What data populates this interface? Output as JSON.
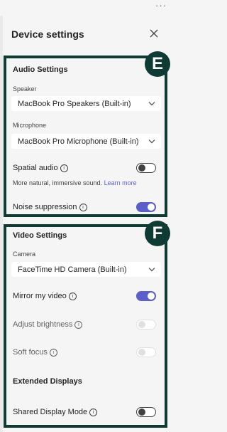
{
  "topbar": {
    "more_glyph": "···"
  },
  "header": {
    "title": "Device settings",
    "close_icon": "close-icon"
  },
  "badges": {
    "e": "E",
    "f": "F"
  },
  "audio": {
    "heading": "Audio Settings",
    "speaker_label": "Speaker",
    "speaker_value": "MacBook Pro Speakers (Built-in)",
    "microphone_label": "Microphone",
    "microphone_value": "MacBook Pro Microphone (Built-in)",
    "spatial_label": "Spatial audio",
    "spatial_on": false,
    "spatial_desc": "More natural, immersive sound.",
    "spatial_link": "Learn more",
    "noise_label": "Noise suppression",
    "noise_on": true
  },
  "video": {
    "heading": "Video Settings",
    "camera_label": "Camera",
    "camera_value": "FaceTime HD Camera (Built-in)",
    "mirror_label": "Mirror my video",
    "mirror_on": true,
    "brightness_label": "Adjust brightness",
    "brightness_enabled": false,
    "softfocus_label": "Soft focus",
    "softfocus_enabled": false
  },
  "extended": {
    "heading": "Extended Displays",
    "shared_label": "Shared Display Mode",
    "shared_on": false
  },
  "colors": {
    "accent": "#5b5fc7",
    "frame": "#0f3b34"
  }
}
